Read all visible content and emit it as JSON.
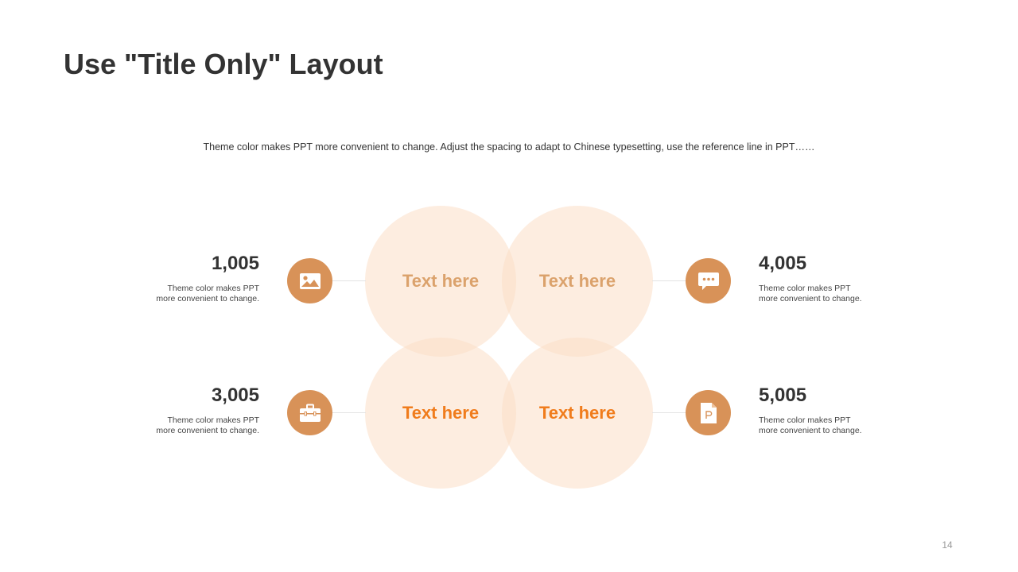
{
  "slide": {
    "title": "Use \"Title Only\" Layout",
    "subtitle": "Theme color makes PPT more convenient  to change.  Adjust  the spacing  to adapt to Chinese  typesetting,  use the reference line in PPT……",
    "page_number": "14"
  },
  "circles": {
    "top_left": "Text here",
    "top_right": "Text here",
    "bottom_left": "Text here",
    "bottom_right": "Text here"
  },
  "stats": {
    "top_left": {
      "value": "1,005",
      "line1": "Theme  color makes PPT",
      "line2": "more convenient  to change.",
      "icon": "image-icon"
    },
    "bottom_left": {
      "value": "3,005",
      "line1": "Theme  color makes PPT",
      "line2": "more convenient  to change.",
      "icon": "briefcase-icon"
    },
    "top_right": {
      "value": "4,005",
      "line1": "Theme  color makes PPT",
      "line2": "more convenient  to change.",
      "icon": "chat-bubble-icon"
    },
    "bottom_right": {
      "value": "5,005",
      "line1": "Theme  color makes PPT",
      "line2": "more convenient  to change.",
      "icon": "powerpoint-file-icon"
    }
  },
  "colors": {
    "accent": "#D89258",
    "circle_fill": "#FBDEC7",
    "label_muted": "#DBA26C",
    "label_bright": "#F07C1C",
    "text": "#333333"
  }
}
